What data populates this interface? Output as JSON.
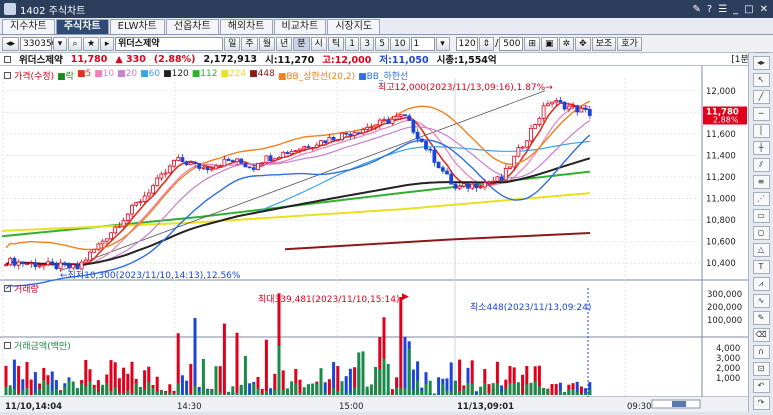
{
  "window": {
    "title": "1402 주식차트",
    "controls": [
      "?",
      "☰",
      "_",
      "□",
      "✕"
    ]
  },
  "tabs": [
    {
      "label": "지수차트",
      "active": false
    },
    {
      "label": "주식차트",
      "active": true
    },
    {
      "label": "ELW차트",
      "active": false
    },
    {
      "label": "선옵차트",
      "active": false
    },
    {
      "label": "해외차트",
      "active": false
    },
    {
      "label": "비교차트",
      "active": false
    },
    {
      "label": "시장지도",
      "active": false
    }
  ],
  "toolbar": {
    "code": "330350",
    "name": "위더스제약",
    "periods": [
      "일",
      "주",
      "월",
      "년",
      "분",
      "시",
      "틱"
    ],
    "minutes": [
      "1",
      "3",
      "5",
      "10"
    ],
    "minute_value": "1",
    "count_value": "120",
    "total_value": "500",
    "btn_view": "보조",
    "btn_quote": "호가"
  },
  "info": {
    "name": "위더스제약",
    "price": "11,780",
    "change": "▲ 330",
    "rate": "(2.88%)",
    "volume": "2,172,913",
    "open": "시:11,270",
    "high": "고:12,000",
    "low": "저:11,050",
    "mcap": "시총:1,554억",
    "interval": "[1분]"
  },
  "legend": {
    "price_label": "가격(수정)",
    "items": [
      {
        "text": "락",
        "color": "#1a8a1a"
      },
      {
        "text": "5",
        "color": "#e0301e"
      },
      {
        "text": "10",
        "color": "#ee7fb6"
      },
      {
        "text": "20",
        "color": "#c97fd3"
      },
      {
        "text": "60",
        "color": "#3aa3ea"
      },
      {
        "text": "120",
        "color": "#222222"
      },
      {
        "text": "112",
        "color": "#30b030"
      },
      {
        "text": "224",
        "color": "#e8e020"
      },
      {
        "text": "448",
        "color": "#8b1a1a"
      },
      {
        "text": "BB_상한선(20,2)",
        "color": "#f08020"
      },
      {
        "text": "BB_하한선",
        "color": "#2f6fe0"
      }
    ]
  },
  "annotations": {
    "high": "최고12,000(2023/11/13,09:16),1.87%→",
    "low": "←최저10,300(2023/11/10,14:13),12.56%",
    "vol_max": "최대339,481(2023/11/10,15:14)",
    "vol_min": "최소448(2023/11/13,09:24)"
  },
  "price_axis": {
    "ticks": [
      "12,000",
      "11,800",
      "11,600",
      "11,400",
      "11,200",
      "11,000",
      "10,800",
      "10,600",
      "10,400"
    ],
    "current": "11,780",
    "current_rate": "2.88%"
  },
  "volume_panel": {
    "label": "거래량",
    "ticks": [
      "300,000",
      "200,000",
      "100,000"
    ]
  },
  "amount_panel": {
    "label": "거래금액(백만)",
    "ticks": [
      "4,000",
      "3,000",
      "2,000",
      "1,000"
    ]
  },
  "time_axis": {
    "labels": [
      "11/10,14:04",
      "14:30",
      "15:00",
      "11/13,09:01",
      "09:30"
    ]
  },
  "colors": {
    "up": "#e0001b",
    "down": "#1c45d8",
    "amount": "#1a8a4a",
    "header": "#2b3e5c"
  }
}
